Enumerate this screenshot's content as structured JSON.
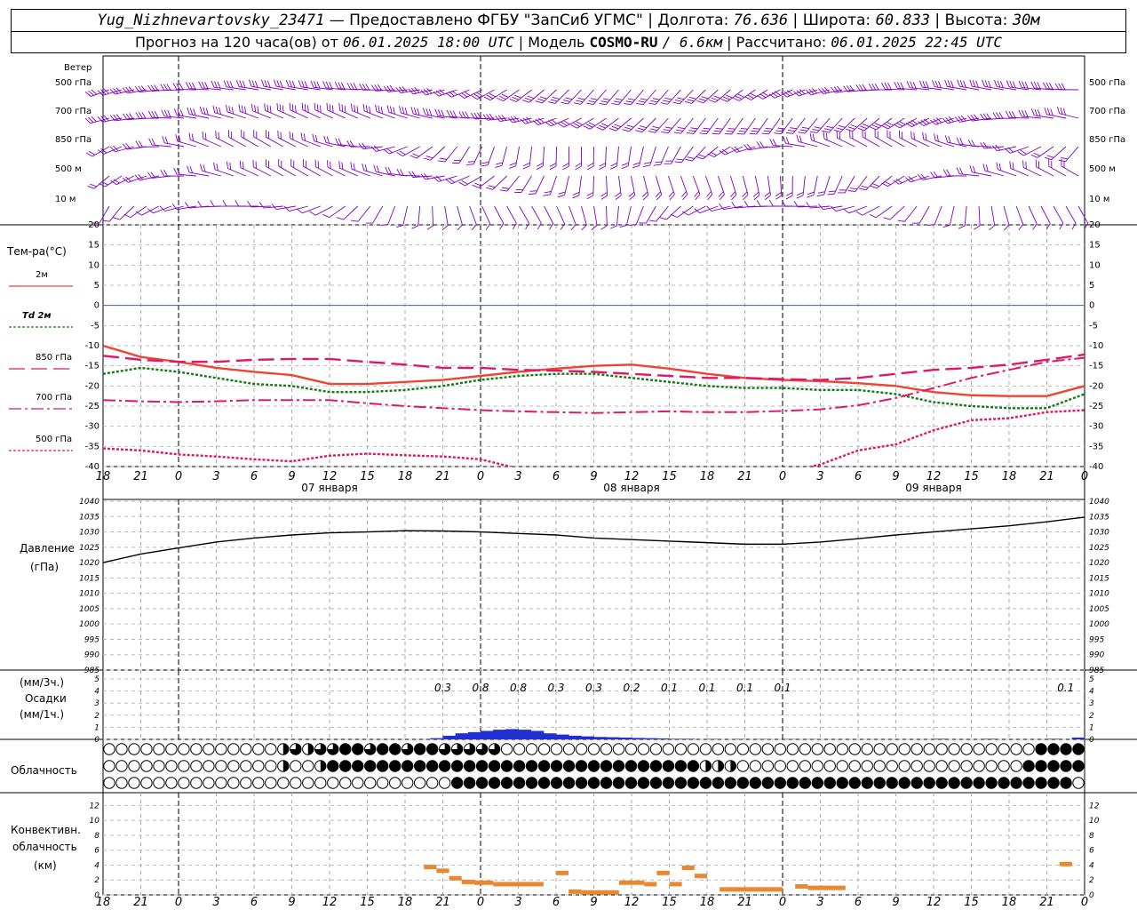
{
  "header": {
    "station": "Yug_Nizhnevartovsky_23471",
    "provided_by": "— Предоставлено ФГБУ \"ЗапСиб УГМС\"",
    "lon_label": "Долгота:",
    "lon": "76.636",
    "lat_label": "Широта:",
    "lat": "60.833",
    "alt_label": "Высота:",
    "alt": "30м",
    "forecast_prefix": "Прогноз на 120 часа(ов) от",
    "forecast_start": "06.01.2025 18:00 UTC",
    "model_label": "| Модель",
    "model": "COSMO-RU",
    "model_res": "/ 6.6км",
    "calc_label": "| Рассчитано:",
    "calc_time": "06.01.2025 22:45 UTC"
  },
  "wind_panel": {
    "title": "Ветер",
    "levels": [
      "500 гПа",
      "700 гПа",
      "850 гПа",
      "500 м",
      "10 м"
    ],
    "barb_color": "#8000c0"
  },
  "time_axis": {
    "hour_labels": [
      "18",
      "21",
      "0",
      "3",
      "6",
      "9",
      "12",
      "15",
      "18",
      "21",
      "0",
      "3",
      "6",
      "9",
      "12",
      "15",
      "18",
      "21",
      "0",
      "3",
      "6",
      "9",
      "12",
      "15",
      "18",
      "21",
      "0"
    ],
    "dates": [
      "07 января",
      "08 января",
      "09 января"
    ]
  },
  "colors": {
    "t2m": "#ee4433",
    "td2m": "#157a15",
    "t850": "#e01868",
    "t700": "#e01868",
    "t500": "#e01868",
    "zero_line": "#4060e0",
    "pressure": "#000000",
    "precip": "#2030d0",
    "convective": "#e88830"
  },
  "chart_data": [
    {
      "type": "line",
      "title": "Тем-ра(°C)",
      "ylim": [
        -40,
        20
      ],
      "yticks": [
        20,
        15,
        10,
        5,
        0,
        -5,
        -10,
        -15,
        -20,
        -25,
        -30,
        -35,
        -40
      ],
      "x_hours": [
        0,
        3,
        6,
        9,
        12,
        15,
        18,
        21,
        24,
        27,
        30,
        33,
        36,
        39,
        42,
        45,
        48,
        51,
        54,
        57,
        60,
        63,
        66,
        69,
        72,
        75,
        78
      ],
      "series": [
        {
          "name": "2м",
          "values": [
            -10,
            -12.8,
            -14,
            -15.5,
            -16.5,
            -17.3,
            -19.5,
            -19.5,
            -19,
            -18.5,
            -17.5,
            -16.5,
            -15.7,
            -15,
            -14.7,
            -15.7,
            -17,
            -18,
            -18.5,
            -18.8,
            -19.3,
            -20,
            -21.5,
            -22.3,
            -22.5,
            -22.5,
            -20
          ]
        },
        {
          "name": "Td 2м",
          "values": [
            -17,
            -15.5,
            -16.5,
            -18,
            -19.5,
            -20,
            -21.5,
            -21.5,
            -21,
            -20,
            -18.5,
            -17.5,
            -17,
            -17,
            -18,
            -19,
            -20,
            -20.5,
            -20.5,
            -21,
            -21,
            -22,
            -24,
            -25,
            -25.5,
            -25.5,
            -22
          ]
        },
        {
          "name": "850 гПа",
          "values": [
            -12.5,
            -13.5,
            -14,
            -14,
            -13.5,
            -13.3,
            -13.3,
            -14,
            -14.7,
            -15.5,
            -15.5,
            -16,
            -16.2,
            -16.5,
            -17,
            -17.5,
            -18,
            -18,
            -18.3,
            -18.5,
            -18,
            -17,
            -16,
            -15.5,
            -14.7,
            -13.5,
            -12.2
          ]
        },
        {
          "name": "700 гПа",
          "values": [
            -23.5,
            -23.8,
            -24,
            -23.8,
            -23.5,
            -23.5,
            -23.5,
            -24.3,
            -25,
            -25.5,
            -26,
            -26.3,
            -26.5,
            -26.7,
            -26.5,
            -26.3,
            -26.5,
            -26.5,
            -26.2,
            -25.8,
            -24.8,
            -23,
            -20.5,
            -18,
            -16,
            -14,
            -13
          ]
        },
        {
          "name": "500 гПа",
          "values": [
            -35.5,
            -36,
            -37,
            -37.5,
            -38.2,
            -38.7,
            -37.3,
            -36.8,
            -37.2,
            -37.5,
            -38.2,
            -40.5,
            -43,
            -46,
            -47.5,
            -47,
            -45,
            -43.5,
            -41.5,
            -39.5,
            -36,
            -34.5,
            -31,
            -28.5,
            -28,
            -26.5,
            -26
          ]
        }
      ]
    },
    {
      "type": "line",
      "title": "Давление",
      "ylabel": "(гПа)",
      "ylim": [
        985,
        1040
      ],
      "yticks": [
        1040,
        1035,
        1030,
        1025,
        1020,
        1015,
        1010,
        1005,
        1000,
        995,
        990,
        985
      ],
      "x_hours": [
        0,
        3,
        6,
        9,
        12,
        15,
        18,
        21,
        24,
        27,
        30,
        33,
        36,
        39,
        42,
        45,
        48,
        51,
        54,
        57,
        60,
        63,
        66,
        69,
        72,
        75,
        78
      ],
      "series": [
        {
          "name": "Давление",
          "values": [
            1020,
            1022.8,
            1024.8,
            1026.7,
            1028,
            1029,
            1029.7,
            1030,
            1030.4,
            1030.3,
            1030,
            1029.5,
            1029,
            1028,
            1027.5,
            1027,
            1026.5,
            1026,
            1026,
            1026.7,
            1027.8,
            1029,
            1030,
            1031,
            1032,
            1033.3,
            1034.8
          ]
        }
      ]
    },
    {
      "type": "bar",
      "title": "Осадки",
      "ylabel_top": "(мм/3ч.)",
      "ylabel_bottom": "(мм/1ч.)",
      "ylim": [
        0,
        5
      ],
      "yticks": [
        5,
        4,
        3,
        2,
        1,
        0
      ],
      "labels_3h": [
        {
          "hour": 27,
          "value": "0.3"
        },
        {
          "hour": 30,
          "value": "0.8"
        },
        {
          "hour": 33,
          "value": "0.8"
        },
        {
          "hour": 36,
          "value": "0.3"
        },
        {
          "hour": 39,
          "value": "0.3"
        },
        {
          "hour": 42,
          "value": "0.2"
        },
        {
          "hour": 45,
          "value": "0.1"
        },
        {
          "hour": 48,
          "value": "0.1"
        },
        {
          "hour": 51,
          "value": "0.1"
        },
        {
          "hour": 54,
          "value": "0.1"
        },
        {
          "hour": 76.5,
          "value": "0.1"
        }
      ]
    },
    {
      "type": "table",
      "title": "Облачность",
      "rows": 3
    },
    {
      "type": "bar",
      "title": "Конвективн. облачность",
      "ylabel": "(км)",
      "ylim": [
        0,
        13
      ],
      "yticks": [
        12,
        10,
        8,
        6,
        4,
        2,
        0
      ]
    }
  ]
}
